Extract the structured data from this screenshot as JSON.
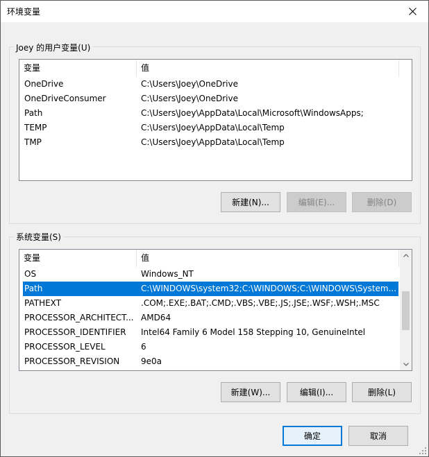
{
  "window": {
    "title": "环境变量"
  },
  "user_vars": {
    "group_label": "Joey 的用户变量(U)",
    "columns": [
      "变量",
      "值"
    ],
    "rows": [
      {
        "name": "OneDrive",
        "value": "C:\\Users\\Joey\\OneDrive"
      },
      {
        "name": "OneDriveConsumer",
        "value": "C:\\Users\\Joey\\OneDrive"
      },
      {
        "name": "Path",
        "value": "C:\\Users\\Joey\\AppData\\Local\\Microsoft\\WindowsApps;"
      },
      {
        "name": "TEMP",
        "value": "C:\\Users\\Joey\\AppData\\Local\\Temp"
      },
      {
        "name": "TMP",
        "value": "C:\\Users\\Joey\\AppData\\Local\\Temp"
      }
    ],
    "buttons": {
      "new": "新建(N)...",
      "edit": "编辑(E)...",
      "delete": "删除(D)"
    }
  },
  "system_vars": {
    "group_label": "系统变量(S)",
    "columns": [
      "变量",
      "值"
    ],
    "rows": [
      {
        "name": "OS",
        "value": "Windows_NT"
      },
      {
        "name": "Path",
        "value": "C:\\WINDOWS\\system32;C:\\WINDOWS;C:\\WINDOWS\\System...",
        "selected": true
      },
      {
        "name": "PATHEXT",
        "value": ".COM;.EXE;.BAT;.CMD;.VBS;.VBE;.JS;.JSE;.WSF;.WSH;.MSC"
      },
      {
        "name": "PROCESSOR_ARCHITECT...",
        "value": "AMD64"
      },
      {
        "name": "PROCESSOR_IDENTIFIER",
        "value": "Intel64 Family 6 Model 158 Stepping 10, GenuineIntel"
      },
      {
        "name": "PROCESSOR_LEVEL",
        "value": "6"
      },
      {
        "name": "PROCESSOR_REVISION",
        "value": "9e0a"
      }
    ],
    "buttons": {
      "new": "新建(W)...",
      "edit": "编辑(I)...",
      "delete": "删除(L)"
    }
  },
  "footer": {
    "ok": "确定",
    "cancel": "取消"
  },
  "colors": {
    "selection": "#0078d7",
    "default_button_border": "#0078d7"
  }
}
